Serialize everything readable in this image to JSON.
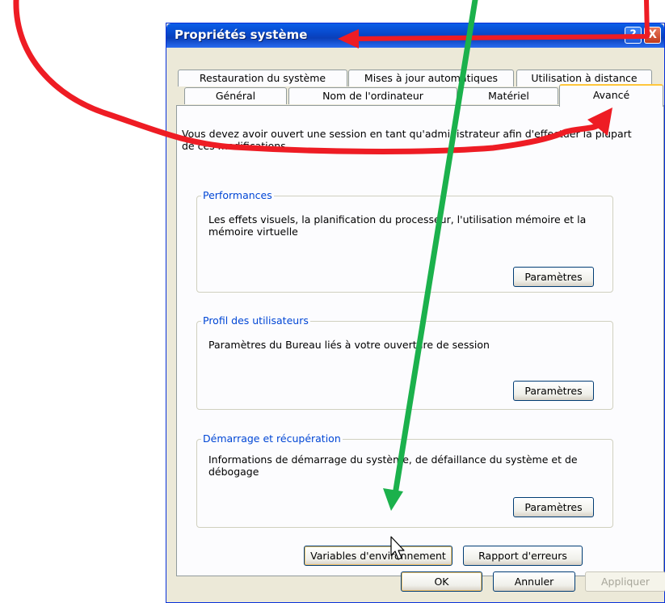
{
  "window": {
    "title": "Propriétés système",
    "help_label": "?",
    "close_label": "X"
  },
  "tabs": {
    "row1": [
      "Restauration du système",
      "Mises à jour automatiques",
      "Utilisation à distance"
    ],
    "row2": [
      "Général",
      "Nom de l'ordinateur",
      "Matériel",
      "Avancé"
    ],
    "active": "Avancé"
  },
  "advanced": {
    "intro": "Vous devez avoir ouvert une session en tant qu'administrateur afin d'effectuer la plupart de ces modifications.",
    "performance": {
      "title": "Performances",
      "description": "Les effets visuels, la planification du processeur, l'utilisation mémoire et la mémoire virtuelle",
      "button": "Paramètres"
    },
    "user_profiles": {
      "title": "Profil des utilisateurs",
      "description": "Paramètres du Bureau liés à votre ouverture de session",
      "button": "Paramètres"
    },
    "startup_recovery": {
      "title": "Démarrage et récupération",
      "description": "Informations de démarrage du système, de défaillance du système et de débogage",
      "button": "Paramètres"
    },
    "env_vars_button": "Variables d'environnement",
    "error_report_button": "Rapport d'erreurs"
  },
  "footer": {
    "ok": "OK",
    "cancel": "Annuler",
    "apply": "Appliquer"
  },
  "annotations": {
    "red_color": "#ee1c24",
    "green_color": "#1bb14c"
  }
}
